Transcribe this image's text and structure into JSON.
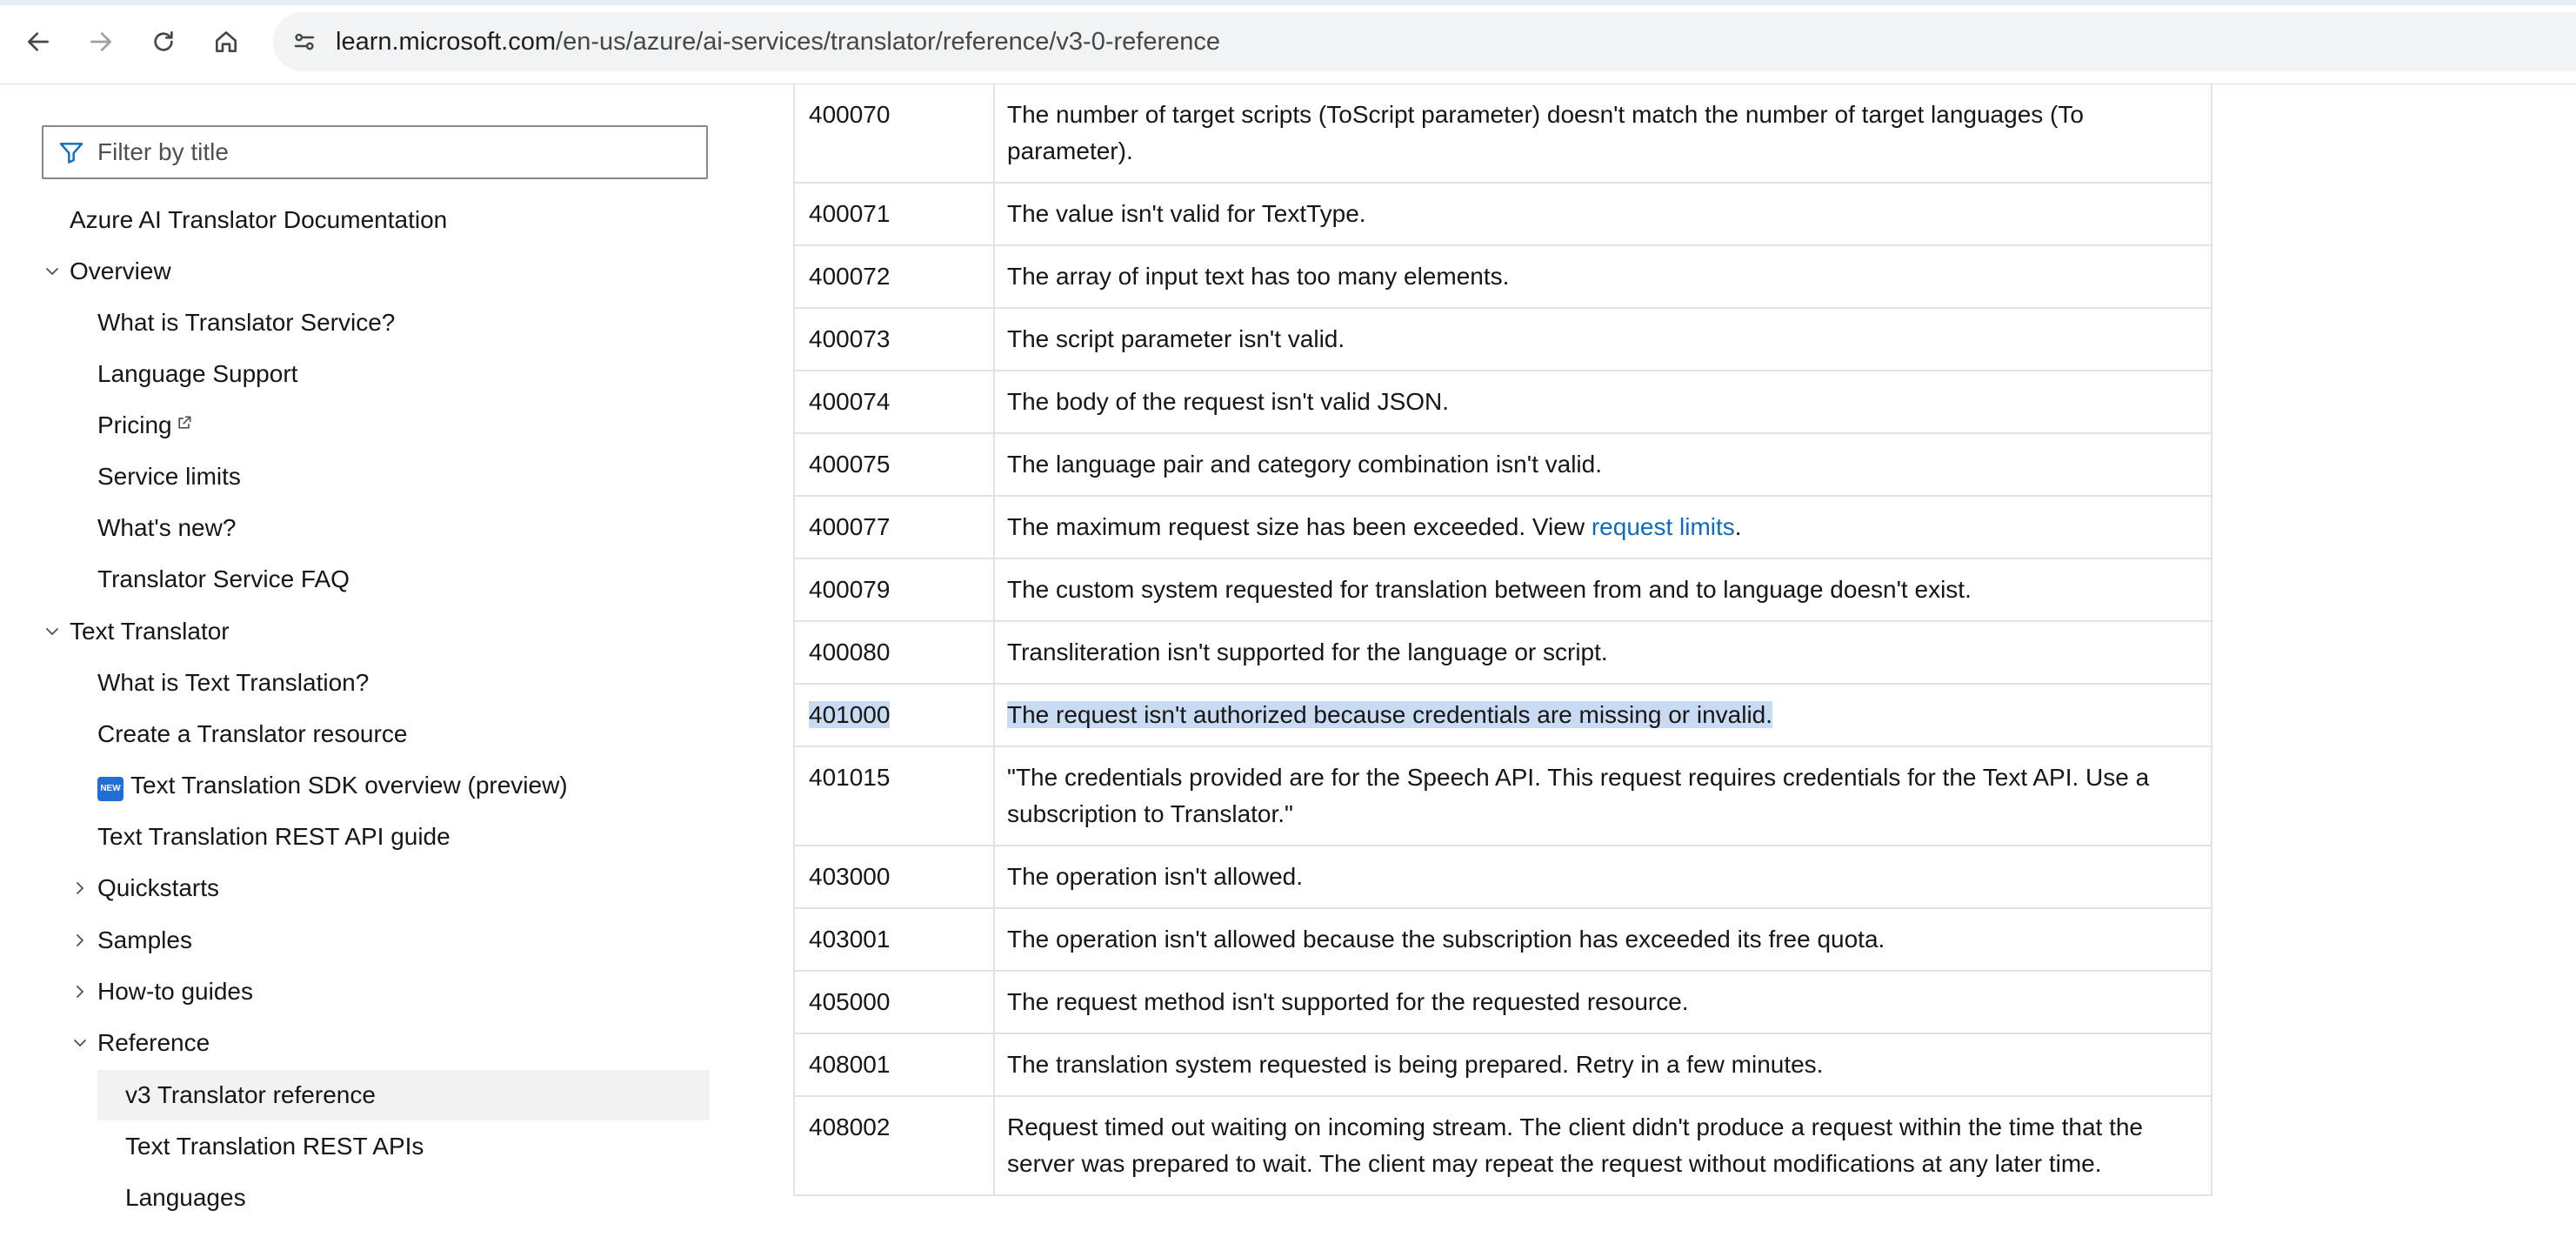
{
  "browser": {
    "url_domain": "learn.microsoft.com",
    "url_path": "/en-us/azure/ai-services/translator/reference/v3-0-reference",
    "icons": [
      "back-icon",
      "forward-icon",
      "reload-icon",
      "home-icon",
      "site-settings-icon"
    ]
  },
  "sidebar": {
    "filter_placeholder": "Filter by title",
    "items": [
      {
        "label": "Azure AI Translator Documentation"
      },
      {
        "label": "Overview"
      },
      {
        "label": "What is Translator Service?"
      },
      {
        "label": "Language Support"
      },
      {
        "label": "Pricing"
      },
      {
        "label": "Service limits"
      },
      {
        "label": "What's new?"
      },
      {
        "label": "Translator Service FAQ"
      },
      {
        "label": "Text Translator"
      },
      {
        "label": "What is Text Translation?"
      },
      {
        "label": "Create a Translator resource"
      },
      {
        "label": "Text Translation SDK overview (preview)",
        "badge": "NEW"
      },
      {
        "label": "Text Translation REST API guide"
      },
      {
        "label": "Quickstarts"
      },
      {
        "label": "Samples"
      },
      {
        "label": "How-to guides"
      },
      {
        "label": "Reference"
      },
      {
        "label": "v3 Translator reference"
      },
      {
        "label": "Text Translation REST APIs"
      },
      {
        "label": "Languages"
      }
    ]
  },
  "errors": {
    "rows": [
      {
        "code": "400070",
        "message": "The number of target scripts (ToScript parameter) doesn't match the number of target languages (To parameter)."
      },
      {
        "code": "400071",
        "message": "The value isn't valid for TextType."
      },
      {
        "code": "400072",
        "message": "The array of input text has too many elements."
      },
      {
        "code": "400073",
        "message": "The script parameter isn't valid."
      },
      {
        "code": "400074",
        "message": "The body of the request isn't valid JSON."
      },
      {
        "code": "400075",
        "message": "The language pair and category combination isn't valid."
      },
      {
        "code": "400077",
        "message_before": "The maximum request size has been exceeded. View ",
        "link": "request limits",
        "message_after": "."
      },
      {
        "code": "400079",
        "message": "The custom system requested for translation between from and to language doesn't exist."
      },
      {
        "code": "400080",
        "message": "Transliteration isn't supported for the language or script."
      },
      {
        "code": "401000",
        "message": "The request isn't authorized because credentials are missing or invalid."
      },
      {
        "code": "401015",
        "message": "\"The credentials provided are for the Speech API. This request requires credentials for the Text API. Use a subscription to Translator.\""
      },
      {
        "code": "403000",
        "message": "The operation isn't allowed."
      },
      {
        "code": "403001",
        "message": "The operation isn't allowed because the subscription has exceeded its free quota."
      },
      {
        "code": "405000",
        "message": "The request method isn't supported for the requested resource."
      },
      {
        "code": "408001",
        "message": "The translation system requested is being prepared. Retry in a few minutes."
      },
      {
        "code": "408002",
        "message": "Request timed out waiting on incoming stream. The client didn't produce a request within the time that the server was prepared to wait. The client may repeat the request without modifications at any later time."
      }
    ]
  }
}
